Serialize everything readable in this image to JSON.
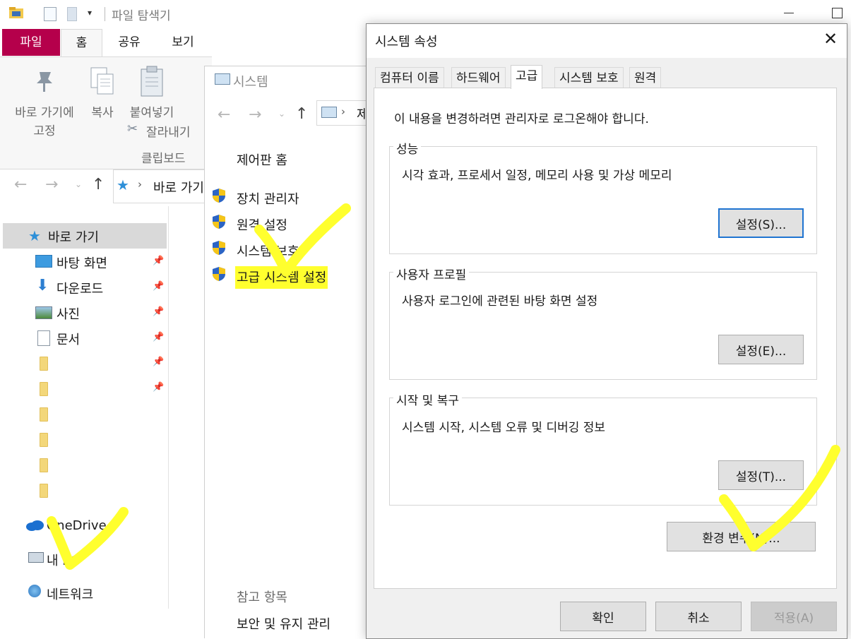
{
  "explorer": {
    "title": "파일 탐색기",
    "ribbon_tabs": [
      "파일",
      "홈",
      "공유",
      "보기"
    ],
    "ribbon": {
      "pin_label_line1": "바로 가기에",
      "pin_label_line2": "고정",
      "copy_label": "복사",
      "paste_label": "붙여넣기",
      "cut_label": "잘라내기",
      "group_label": "클립보드"
    },
    "address": "바로 가기",
    "tree": {
      "quick_access": "바로 가기",
      "desktop": "바탕 화면",
      "downloads": "다운로드",
      "pictures": "사진",
      "documents": "문서",
      "onedrive": "OneDrive",
      "this_pc": "내 PC",
      "network": "네트워크"
    }
  },
  "system": {
    "title": "시스템",
    "address_partial": "제",
    "control_panel_home": "제어판 홈",
    "links": [
      "장치 관리자",
      "원격 설정",
      "시스템 보호",
      "고급 시스템 설정"
    ],
    "see_also": "참고 항목",
    "security_maintenance": "보안 및 유지 관리"
  },
  "dialog": {
    "title": "시스템 속성",
    "close_icon": "close-icon",
    "tabs": [
      "컴퓨터 이름",
      "하드웨어",
      "고급",
      "시스템 보호",
      "원격"
    ],
    "active_tab": "고급",
    "admin_notice": "이 내용을 변경하려면 관리자로 로그온해야 합니다.",
    "performance": {
      "title": "성능",
      "desc": "시각 효과, 프로세서 일정, 메모리 사용 및 가상 메모리",
      "button": "설정(S)..."
    },
    "user_profiles": {
      "title": "사용자 프로필",
      "desc": "사용자 로그인에 관련된 바탕 화면 설정",
      "button": "설정(E)..."
    },
    "startup_recovery": {
      "title": "시작 및 복구",
      "desc": "시스템 시작, 시스템 오류 및 디버깅 정보",
      "button": "설정(T)..."
    },
    "env_button": "환경 변수(N)...",
    "ok": "확인",
    "cancel": "취소",
    "apply": "적용(A)"
  },
  "colors": {
    "file_tab": "#b5004b",
    "highlight": "#ffff2e",
    "focus_border": "#1f74d1"
  }
}
